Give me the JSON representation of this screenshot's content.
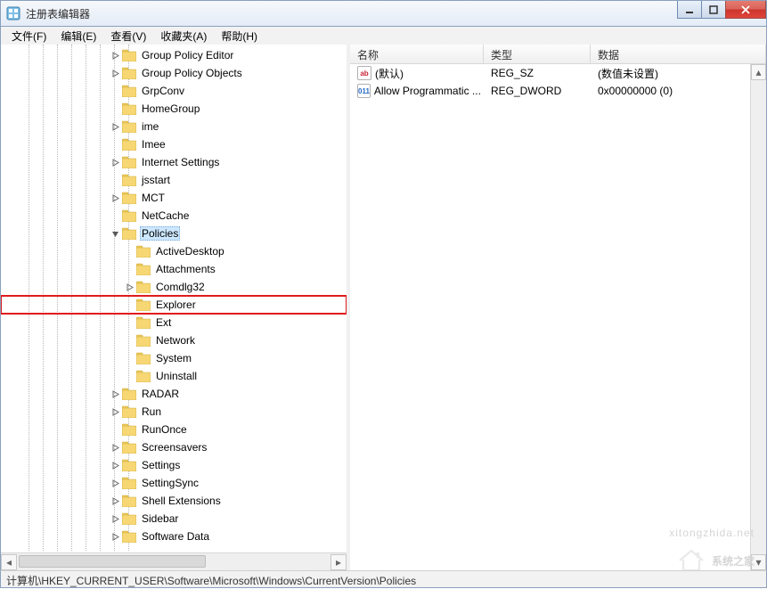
{
  "window": {
    "title": "注册表编辑器"
  },
  "menu": {
    "file": "文件(F)",
    "edit": "编辑(E)",
    "view": "查看(V)",
    "favorites": "收藏夹(A)",
    "help": "帮助(H)"
  },
  "tree": {
    "items": [
      {
        "indent": 7,
        "expand": "closed",
        "label": "Group Policy Editor"
      },
      {
        "indent": 7,
        "expand": "closed",
        "label": "Group Policy Objects"
      },
      {
        "indent": 7,
        "expand": "none",
        "label": "GrpConv"
      },
      {
        "indent": 7,
        "expand": "none",
        "label": "HomeGroup"
      },
      {
        "indent": 7,
        "expand": "closed",
        "label": "ime"
      },
      {
        "indent": 7,
        "expand": "none",
        "label": "Imee"
      },
      {
        "indent": 7,
        "expand": "closed",
        "label": "Internet Settings"
      },
      {
        "indent": 7,
        "expand": "none",
        "label": "jsstart"
      },
      {
        "indent": 7,
        "expand": "closed",
        "label": "MCT"
      },
      {
        "indent": 7,
        "expand": "none",
        "label": "NetCache"
      },
      {
        "indent": 7,
        "expand": "open",
        "label": "Policies",
        "selected": true
      },
      {
        "indent": 8,
        "expand": "none",
        "label": "ActiveDesktop"
      },
      {
        "indent": 8,
        "expand": "none",
        "label": "Attachments"
      },
      {
        "indent": 8,
        "expand": "closed",
        "label": "Comdlg32"
      },
      {
        "indent": 8,
        "expand": "none",
        "label": "Explorer",
        "highlighted": true
      },
      {
        "indent": 8,
        "expand": "none",
        "label": "Ext"
      },
      {
        "indent": 8,
        "expand": "none",
        "label": "Network"
      },
      {
        "indent": 8,
        "expand": "none",
        "label": "System"
      },
      {
        "indent": 8,
        "expand": "none",
        "label": "Uninstall"
      },
      {
        "indent": 7,
        "expand": "closed",
        "label": "RADAR"
      },
      {
        "indent": 7,
        "expand": "closed",
        "label": "Run"
      },
      {
        "indent": 7,
        "expand": "none",
        "label": "RunOnce"
      },
      {
        "indent": 7,
        "expand": "closed",
        "label": "Screensavers"
      },
      {
        "indent": 7,
        "expand": "closed",
        "label": "Settings"
      },
      {
        "indent": 7,
        "expand": "closed",
        "label": "SettingSync"
      },
      {
        "indent": 7,
        "expand": "closed",
        "label": "Shell Extensions"
      },
      {
        "indent": 7,
        "expand": "closed",
        "label": "Sidebar"
      },
      {
        "indent": 7,
        "expand": "closed",
        "label": "Software Data"
      }
    ],
    "guide_indents": [
      1,
      2,
      3,
      4,
      5,
      6,
      7,
      8
    ]
  },
  "list": {
    "columns": {
      "name": "名称",
      "type": "类型",
      "data": "数据"
    },
    "rows": [
      {
        "icon": "sz",
        "name": "(默认)",
        "type": "REG_SZ",
        "data": "(数值未设置)"
      },
      {
        "icon": "dw",
        "name": "Allow Programmatic ...",
        "type": "REG_DWORD",
        "data": "0x00000000 (0)"
      }
    ]
  },
  "status": {
    "path": "计算机\\HKEY_CURRENT_USER\\Software\\Microsoft\\Windows\\CurrentVersion\\Policies"
  },
  "watermark": {
    "small": "xitongzhida.net",
    "large": "系统之家"
  },
  "icons": {
    "sz_text": "ab",
    "dw_text": "011"
  }
}
